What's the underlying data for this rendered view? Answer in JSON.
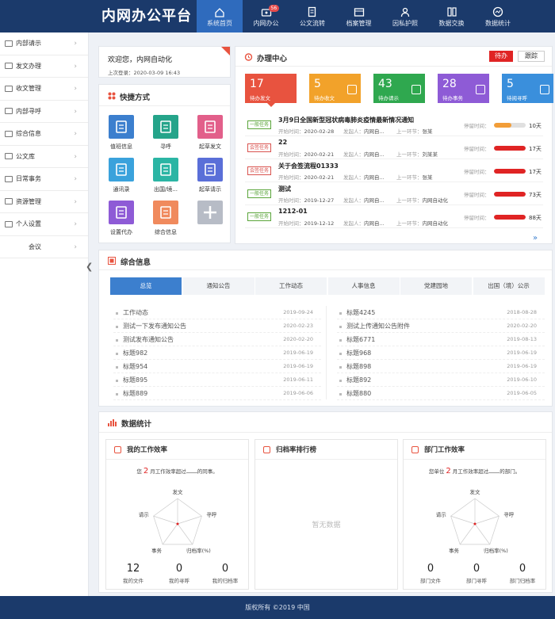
{
  "app": {
    "title": "内网办公平台"
  },
  "nav": [
    {
      "label": "系统首页",
      "icon": "home-icon",
      "active": true
    },
    {
      "label": "内网办公",
      "icon": "briefcase-icon",
      "badge": "56"
    },
    {
      "label": "公文流转",
      "icon": "document-flow-icon"
    },
    {
      "label": "档案管理",
      "icon": "archive-icon"
    },
    {
      "label": "因私护照",
      "icon": "passport-icon"
    },
    {
      "label": "数据交换",
      "icon": "exchange-icon"
    },
    {
      "label": "数据统计",
      "icon": "chart-icon"
    }
  ],
  "sidebar": [
    {
      "label": "内部请示"
    },
    {
      "label": "发文办理"
    },
    {
      "label": "收文管理"
    },
    {
      "label": "内部寻呼"
    },
    {
      "label": "综合信息"
    },
    {
      "label": "公文库"
    },
    {
      "label": "日常事务"
    },
    {
      "label": "资源管理"
    },
    {
      "label": "个人设置"
    },
    {
      "label": "会议"
    }
  ],
  "welcome": {
    "greeting": "欢迎您，内网自动化",
    "last_login_label": "上次登录：",
    "last_login": "2020-03-09 16:43"
  },
  "shortcuts": {
    "title": "快捷方式",
    "items": [
      {
        "label": "值班信息",
        "color": "#3c7fce",
        "icon": "duty-icon"
      },
      {
        "label": "寻呼",
        "color": "#25a48a",
        "icon": "phone-icon"
      },
      {
        "label": "起草发文",
        "color": "#e25f8a",
        "icon": "draft-icon"
      },
      {
        "label": "通讯录",
        "color": "#3aa2dc",
        "icon": "contacts-icon"
      },
      {
        "label": "出国/境...",
        "color": "#2bb5a4",
        "icon": "plane-icon"
      },
      {
        "label": "起草请示",
        "color": "#5a6fd8",
        "icon": "request-icon"
      },
      {
        "label": "设置代办",
        "color": "#8e5bd6",
        "icon": "settings-icon"
      },
      {
        "label": "综合信息",
        "color": "#f08a5d",
        "icon": "info-icon"
      },
      {
        "label": "",
        "color": "#b7bcc6",
        "icon": "add-icon"
      }
    ]
  },
  "center": {
    "title": "办理中心",
    "btn_pending": "待办",
    "btn_track": "跟踪",
    "tiles": [
      {
        "count": "17",
        "label": "待办发文",
        "color": "#e8533f"
      },
      {
        "count": "5",
        "label": "待办收文",
        "color": "#f2a22a"
      },
      {
        "count": "43",
        "label": "待办请示",
        "color": "#2fa84f"
      },
      {
        "count": "28",
        "label": "待办事务",
        "color": "#8e5bd6"
      },
      {
        "count": "5",
        "label": "待阅寻呼",
        "color": "#3a8fdc"
      }
    ],
    "items": [
      {
        "tag": "一般任务",
        "tagType": "g",
        "title": "3月9日全国新型冠状病毒肺炎疫情最新情况通知",
        "start_label": "开始时间：",
        "start": "2020-02-28",
        "sender_label": "发起人：",
        "sender": "内网自...",
        "prev_label": "上一环节：",
        "prev": "张某",
        "stay_label": "停留时间：",
        "progress": 0.55,
        "barColor": "#f29d38",
        "days": "10天"
      },
      {
        "tag": "会签任务",
        "tagType": "r",
        "title": "22",
        "start_label": "开始时间：",
        "start": "2020-02-21",
        "sender_label": "发起人：",
        "sender": "内网自...",
        "prev_label": "上一环节：",
        "prev": "刘某某",
        "stay_label": "停留时间：",
        "progress": 1,
        "barColor": "#e02424",
        "days": "17天"
      },
      {
        "tag": "会签任务",
        "tagType": "r",
        "title": "关于会签流程01333",
        "start_label": "开始时间：",
        "start": "2020-02-21",
        "sender_label": "发起人：",
        "sender": "内网自...",
        "prev_label": "上一环节：",
        "prev": "张某",
        "stay_label": "停留时间：",
        "progress": 1,
        "barColor": "#e02424",
        "days": "17天"
      },
      {
        "tag": "一般任务",
        "tagType": "g",
        "title": "测试",
        "start_label": "开始时间：",
        "start": "2019-12-27",
        "sender_label": "发起人：",
        "sender": "内网自...",
        "prev_label": "上一环节：",
        "prev": "内网自动化",
        "stay_label": "停留时间：",
        "progress": 1,
        "barColor": "#e02424",
        "days": "73天"
      },
      {
        "tag": "一般任务",
        "tagType": "g",
        "title": "1212-01",
        "start_label": "开始时间：",
        "start": "2019-12-12",
        "sender_label": "发起人：",
        "sender": "内网自...",
        "prev_label": "上一环节：",
        "prev": "内网自动化",
        "stay_label": "停留时间：",
        "progress": 1,
        "barColor": "#e02424",
        "days": "88天"
      }
    ],
    "more": "»"
  },
  "info": {
    "title": "综合信息",
    "tabs": [
      "总览",
      "通知公告",
      "工作动态",
      "人事信息",
      "党建园地",
      "出国（境）公示"
    ],
    "left": [
      [
        "工作动态",
        "2019-09-24"
      ],
      [
        "测试一下发布通知公告",
        "2020-02-23"
      ],
      [
        "测试发布通知公告",
        "2020-02-20"
      ],
      [
        "标题982",
        "2019-06-19"
      ],
      [
        "标题954",
        "2019-06-19"
      ],
      [
        "标题895",
        "2019-06-11"
      ],
      [
        "标题889",
        "2019-06-06"
      ]
    ],
    "right": [
      [
        "标题4245",
        "2018-08-28"
      ],
      [
        "测试上传通知公告附件",
        "2020-02-20"
      ],
      [
        "标题6771",
        "2019-08-13"
      ],
      [
        "标题968",
        "2019-06-19"
      ],
      [
        "标题898",
        "2019-06-19"
      ],
      [
        "标题892",
        "2019-06-10"
      ],
      [
        "标题880",
        "2019-06-05"
      ]
    ]
  },
  "stats": {
    "title": "数据统计",
    "mine": {
      "title": "我的工作效率",
      "prefix": "您",
      "month": "2",
      "suffix": "月工作效率超过",
      "tail": "的同事。",
      "axes": [
        "发文",
        "寻呼",
        "归档率(%)",
        "事务",
        "请示"
      ],
      "values": [
        {
          "v": "12",
          "l": "我的文件"
        },
        {
          "v": "0",
          "l": "我的寻呼"
        },
        {
          "v": "0",
          "l": "我的归档率"
        }
      ]
    },
    "rank": {
      "title": "归档率排行榜",
      "empty": "暂无数据"
    },
    "dept": {
      "title": "部门工作效率",
      "prefix": "您单位",
      "month": "2",
      "suffix": "月工作效率超过",
      "tail": "的部门。",
      "axes": [
        "发文",
        "寻呼",
        "归档率(%)",
        "事务",
        "请示"
      ],
      "values": [
        {
          "v": "0",
          "l": "部门文件"
        },
        {
          "v": "0",
          "l": "部门寻呼"
        },
        {
          "v": "0",
          "l": "部门归档率"
        }
      ]
    }
  },
  "footer": {
    "text": "版权所有 ©2019 中国"
  },
  "colors": {
    "header": "#1b3a6b",
    "accent": "#3c7fce",
    "danger": "#e02424"
  }
}
